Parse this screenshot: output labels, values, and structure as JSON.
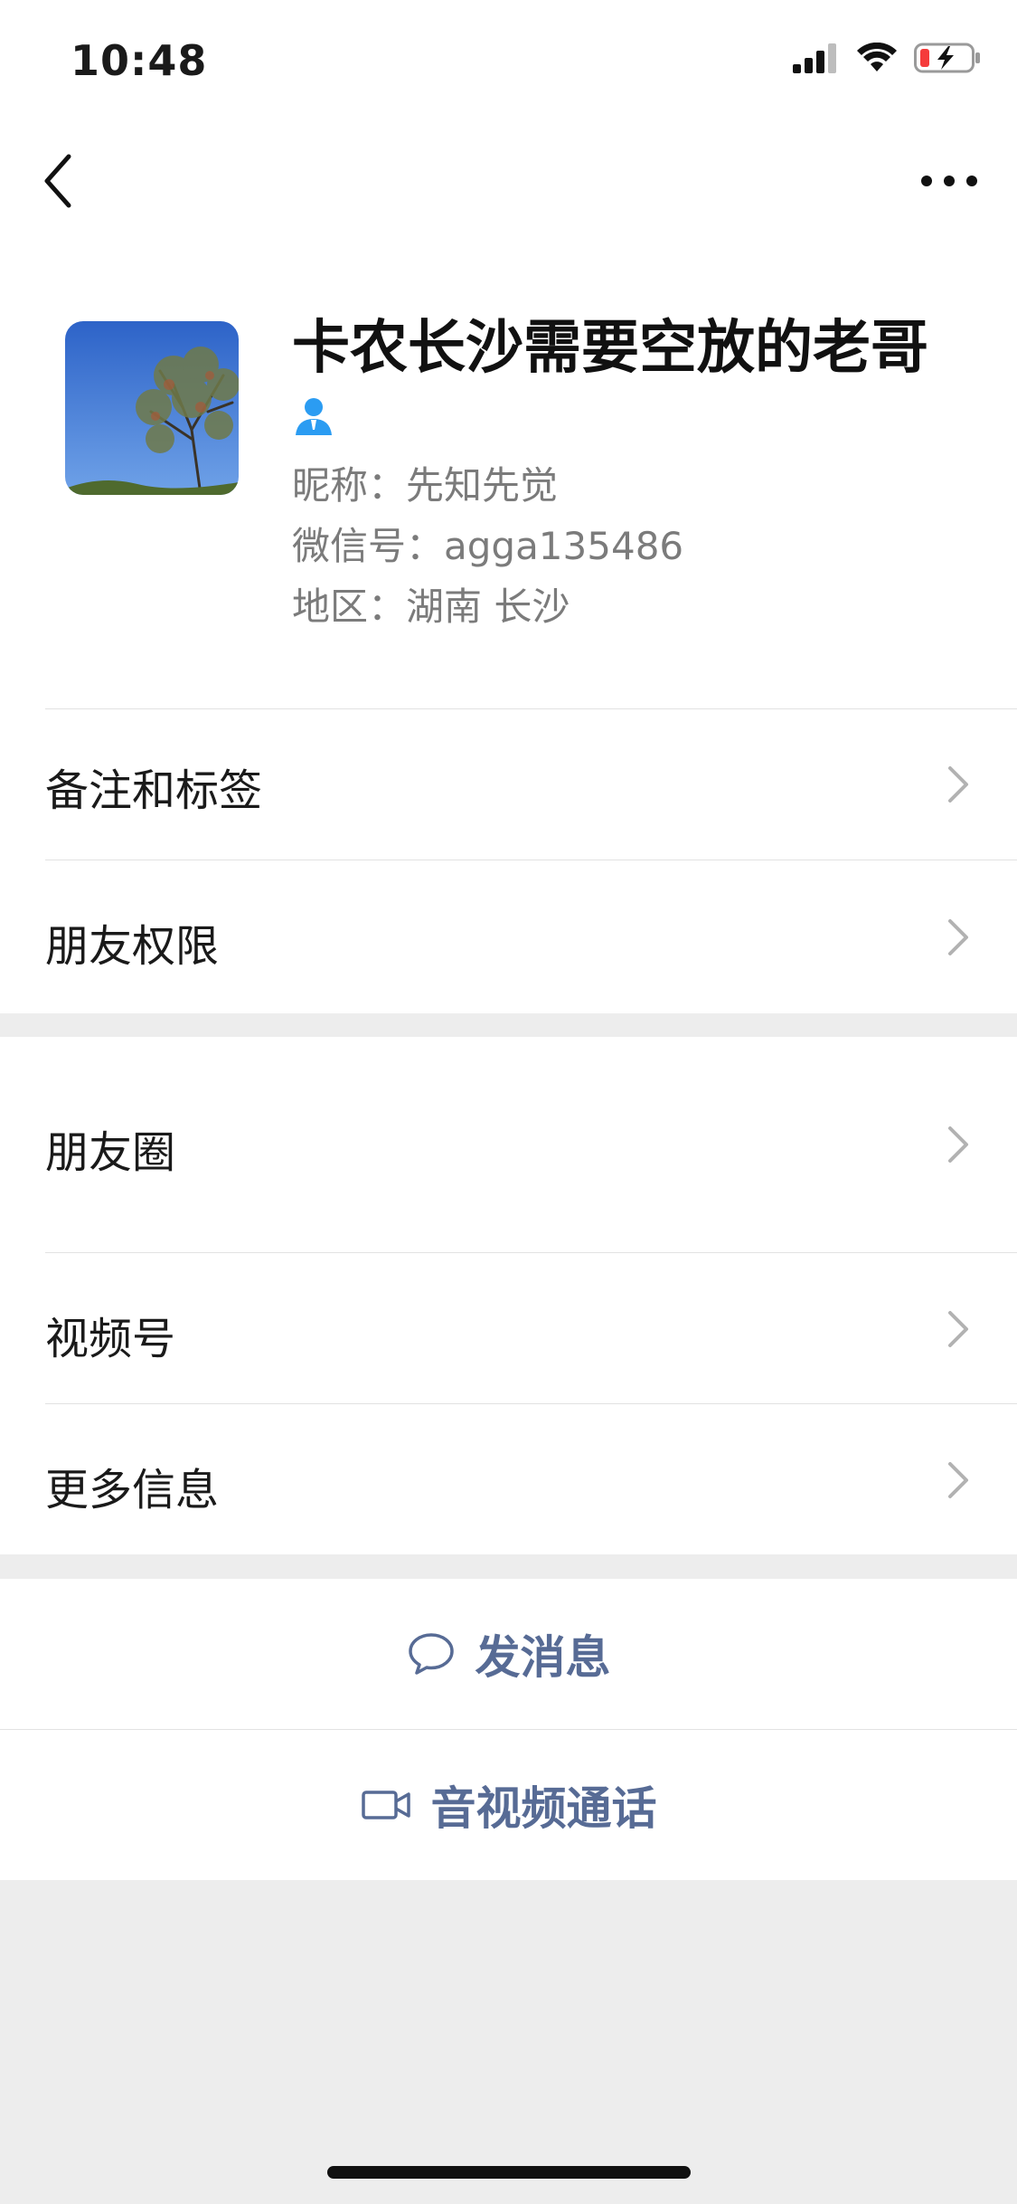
{
  "status_bar": {
    "time": "10:48",
    "icons": [
      "signal-icon",
      "wifi-icon",
      "battery-icon"
    ],
    "battery_color": "#f53b3b"
  },
  "nav": {
    "back_icon": "chevron-left-icon",
    "more_icon": "more-horizontal-icon"
  },
  "profile": {
    "remark_name": "卡农长沙需要空放的老哥",
    "badge_icon": "person-icon",
    "badge_color": "#2b9cf2",
    "nickname_label": "昵称：",
    "nickname": "先知先觉",
    "wechat_id_label": "微信号：",
    "wechat_id": "agga135486",
    "region_label": "地区：",
    "region": "湖南 长沙"
  },
  "group1": [
    {
      "label": "备注和标签"
    },
    {
      "label": "朋友权限"
    }
  ],
  "group2": [
    {
      "label": "朋友圈"
    },
    {
      "label": "视频号"
    },
    {
      "label": "更多信息"
    }
  ],
  "actions": {
    "message": {
      "label": "发消息",
      "icon": "chat-bubble-icon"
    },
    "call": {
      "label": "音视频通话",
      "icon": "video-camera-icon"
    }
  },
  "colors": {
    "background": "#ededed",
    "link": "#576b95"
  }
}
